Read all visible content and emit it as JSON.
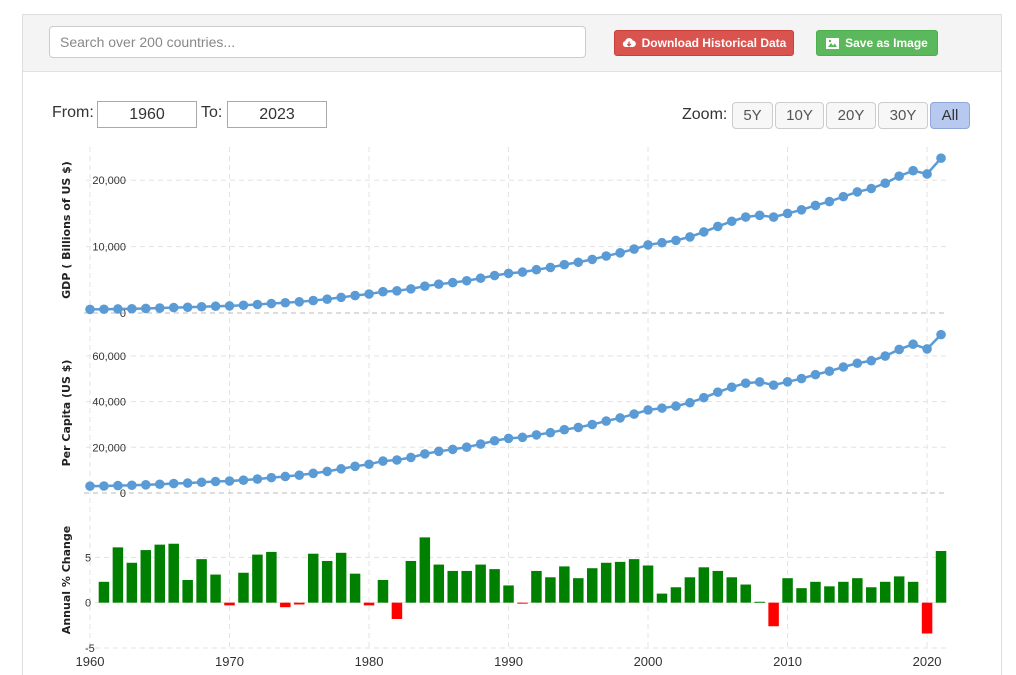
{
  "search": {
    "placeholder": "Search over 200 countries..."
  },
  "buttons": {
    "download": "Download Historical Data",
    "save_image": "Save as Image"
  },
  "range": {
    "from_label": "From:",
    "from_value": "1960",
    "to_label": "To:",
    "to_value": "2023"
  },
  "zoom": {
    "label": "Zoom:",
    "options": [
      "5Y",
      "10Y",
      "20Y",
      "30Y",
      "All"
    ],
    "active": "All"
  },
  "colors": {
    "line": "#5b9bd5",
    "positive": "#008000",
    "negative": "#ff0000",
    "download": "#d9534f",
    "save": "#5cb85c"
  },
  "chart_data": [
    {
      "type": "line",
      "ylabel": "GDP ( Billions of US $)",
      "x": [
        1960,
        1961,
        1962,
        1963,
        1964,
        1965,
        1966,
        1967,
        1968,
        1969,
        1970,
        1971,
        1972,
        1973,
        1974,
        1975,
        1976,
        1977,
        1978,
        1979,
        1980,
        1981,
        1982,
        1983,
        1984,
        1985,
        1986,
        1987,
        1988,
        1989,
        1990,
        1991,
        1992,
        1993,
        1994,
        1995,
        1996,
        1997,
        1998,
        1999,
        2000,
        2001,
        2002,
        2003,
        2004,
        2005,
        2006,
        2007,
        2008,
        2009,
        2010,
        2011,
        2012,
        2013,
        2014,
        2015,
        2016,
        2017,
        2018,
        2019,
        2020,
        2021
      ],
      "values": [
        543,
        563,
        605,
        639,
        686,
        744,
        815,
        862,
        943,
        1020,
        1073,
        1165,
        1280,
        1425,
        1545,
        1685,
        1873,
        2082,
        2352,
        2627,
        2857,
        3207,
        3343,
        3634,
        4037,
        4339,
        4580,
        4855,
        5236,
        5642,
        5963,
        6158,
        6520,
        6859,
        7287,
        7640,
        8073,
        8578,
        9063,
        9631,
        10252,
        10582,
        10936,
        11458,
        12214,
        13037,
        13815,
        14452,
        14713,
        14449,
        14992,
        15543,
        16197,
        16785,
        17527,
        18238,
        18745,
        19543,
        20612,
        21433,
        20937,
        23315
      ],
      "yticks": [
        0,
        10000,
        20000
      ],
      "ytick_labels": [
        "0",
        "10,000",
        "20,000"
      ],
      "ylim": [
        0,
        25000
      ]
    },
    {
      "type": "line",
      "ylabel": "Per Capita (US $)",
      "x": [
        1960,
        1961,
        1962,
        1963,
        1964,
        1965,
        1966,
        1967,
        1968,
        1969,
        1970,
        1971,
        1972,
        1973,
        1974,
        1975,
        1976,
        1977,
        1978,
        1979,
        1980,
        1981,
        1982,
        1983,
        1984,
        1985,
        1986,
        1987,
        1988,
        1989,
        1990,
        1991,
        1992,
        1993,
        1994,
        1995,
        1996,
        1997,
        1998,
        1999,
        2000,
        2001,
        2002,
        2003,
        2004,
        2005,
        2006,
        2007,
        2008,
        2009,
        2010,
        2011,
        2012,
        2013,
        2014,
        2015,
        2016,
        2017,
        2018,
        2019,
        2020,
        2021
      ],
      "values": [
        3007,
        3067,
        3244,
        3375,
        3574,
        3828,
        4146,
        4336,
        4696,
        5032,
        5234,
        5609,
        6094,
        6726,
        7226,
        7801,
        8592,
        9453,
        10565,
        11674,
        12575,
        13976,
        14434,
        15544,
        17121,
        18237,
        19071,
        20039,
        21417,
        22857,
        23889,
        24342,
        25419,
        26387,
        27695,
        28691,
        29968,
        31459,
        32854,
        34515,
        36330,
        37134,
        38023,
        39497,
        41712,
        44115,
        46299,
        48050,
        48570,
        47195,
        48651,
        50066,
        51784,
        53291,
        55124,
        56763,
        57867,
        59915,
        62805,
        65095,
        63028,
        69288
      ],
      "yticks": [
        0,
        20000,
        40000,
        60000
      ],
      "ytick_labels": [
        "0",
        "20,000",
        "40,000",
        "60,000"
      ],
      "ylim": [
        0,
        70000
      ]
    },
    {
      "type": "bar",
      "ylabel": "Annual % Change",
      "x": [
        1961,
        1962,
        1963,
        1964,
        1965,
        1966,
        1967,
        1968,
        1969,
        1970,
        1971,
        1972,
        1973,
        1974,
        1975,
        1976,
        1977,
        1978,
        1979,
        1980,
        1981,
        1982,
        1983,
        1984,
        1985,
        1986,
        1987,
        1988,
        1989,
        1990,
        1991,
        1992,
        1993,
        1994,
        1995,
        1996,
        1997,
        1998,
        1999,
        2000,
        2001,
        2002,
        2003,
        2004,
        2005,
        2006,
        2007,
        2008,
        2009,
        2010,
        2011,
        2012,
        2013,
        2014,
        2015,
        2016,
        2017,
        2018,
        2019,
        2020,
        2021
      ],
      "values": [
        2.3,
        6.1,
        4.4,
        5.8,
        6.4,
        6.5,
        2.5,
        4.8,
        3.1,
        -0.3,
        3.3,
        5.3,
        5.6,
        -0.5,
        -0.2,
        5.4,
        4.6,
        5.5,
        3.2,
        -0.3,
        2.5,
        -1.8,
        4.6,
        7.2,
        4.2,
        3.5,
        3.5,
        4.2,
        3.7,
        1.9,
        -0.1,
        3.5,
        2.8,
        4.0,
        2.7,
        3.8,
        4.4,
        4.5,
        4.8,
        4.1,
        1.0,
        1.7,
        2.8,
        3.9,
        3.5,
        2.8,
        2.0,
        0.1,
        -2.6,
        2.7,
        1.6,
        2.3,
        1.8,
        2.3,
        2.7,
        1.7,
        2.3,
        2.9,
        2.3,
        -3.4,
        5.7
      ],
      "yticks": [
        -5,
        0,
        5
      ],
      "ytick_labels": [
        "-5",
        "0",
        "5"
      ],
      "ylim": [
        -5,
        10
      ]
    }
  ],
  "x_axis": {
    "ticks": [
      1960,
      1970,
      1980,
      1990,
      2000,
      2010,
      2020
    ],
    "tick_labels": [
      "1960",
      "1970",
      "1980",
      "1990",
      "2000",
      "2010",
      "2020"
    ]
  }
}
